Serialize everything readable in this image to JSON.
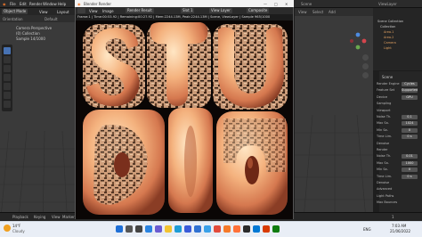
{
  "blender": {
    "menu": [
      "File",
      "Edit",
      "Render",
      "Window",
      "Help"
    ],
    "workspace_tabs": [
      "Object Mode",
      "View",
      "Layout"
    ],
    "left_viewport": {
      "header": [
        "Orientation",
        "Default",
        "Drag"
      ],
      "overlay_lines": [
        "Camera Perspective",
        "(0) Collection",
        "Sample 14/1000"
      ]
    },
    "right_viewport": {
      "header": [
        "View",
        "Select",
        "Add"
      ]
    },
    "outliner": {
      "title": "Scene",
      "view_layer": "ViewLayer",
      "items": [
        "Scene Collection",
        "Collection",
        "Area.1",
        "Area.2",
        "Camera",
        "Light"
      ]
    },
    "properties": {
      "scene_label": "Scene",
      "rows": [
        {
          "label": "Render Engine",
          "value": "Cycles"
        },
        {
          "label": "Feature Set",
          "value": "Supported"
        },
        {
          "label": "Device",
          "value": "GPU"
        },
        {
          "label": "Sampling",
          "value": ""
        },
        {
          "label": "Viewport",
          "value": ""
        },
        {
          "label": "Noise Th.",
          "value": "0.1"
        },
        {
          "label": "Max Sa.",
          "value": "1024"
        },
        {
          "label": "Min Sa.",
          "value": "0"
        },
        {
          "label": "Time Lim.",
          "value": "0 s"
        },
        {
          "label": "Denoise",
          "value": ""
        },
        {
          "label": "Render",
          "value": ""
        },
        {
          "label": "Noise Th.",
          "value": "0.01"
        },
        {
          "label": "Max Sa.",
          "value": "1000"
        },
        {
          "label": "Min Sa.",
          "value": "0"
        },
        {
          "label": "Time Lim.",
          "value": "0 s"
        },
        {
          "label": "Denoise",
          "value": ""
        },
        {
          "label": "Advanced",
          "value": ""
        },
        {
          "label": "Light Paths",
          "value": ""
        },
        {
          "label": "Max Bounces",
          "value": ""
        }
      ]
    },
    "timeline": {
      "items": [
        "Playback",
        "Keying",
        "View",
        "Marker"
      ],
      "frame": "1"
    }
  },
  "render_window": {
    "title": "Blender Render",
    "controls": [
      "—",
      "□",
      "✕"
    ],
    "header_buttons": [
      "View",
      "Image",
      "Render Result",
      "Slot 1",
      "View Layer",
      "Composite"
    ],
    "info": "Frame:1 | Time:00:53.92 | Remaining:00:27.92 | Mem:2244.13M, Peak:2244.13M | Scene, ViewLayer | Sample 965/1000",
    "letters": [
      "S",
      "T",
      "U",
      "D",
      "I",
      "O"
    ]
  },
  "taskbar": {
    "weather_temp": "14°F",
    "weather_desc": "Cloudy",
    "time": "7:03 AM",
    "date": "21/06/2022",
    "lang": "ENG",
    "icons": [
      {
        "name": "start-icon",
        "color": "#1f6fd6"
      },
      {
        "name": "search-taskbar-icon",
        "color": "#555555"
      },
      {
        "name": "task-view-icon",
        "color": "#444444"
      },
      {
        "name": "widgets-icon",
        "color": "#2a83e0"
      },
      {
        "name": "chat-icon",
        "color": "#6b5bd1"
      },
      {
        "name": "explorer-icon",
        "color": "#f2c230"
      },
      {
        "name": "edge-icon",
        "color": "#1d9cd6"
      },
      {
        "name": "store-icon",
        "color": "#3a5bd9"
      },
      {
        "name": "mail-icon",
        "color": "#2f71d1"
      },
      {
        "name": "photos-icon",
        "color": "#3aa0e8"
      },
      {
        "name": "chrome-icon",
        "color": "#e24b3b"
      },
      {
        "name": "blender-icon",
        "color": "#f5792a"
      },
      {
        "name": "firefox-icon",
        "color": "#ff7139"
      },
      {
        "name": "app-icon-1",
        "color": "#2b2b2b"
      },
      {
        "name": "app-icon-2",
        "color": "#0078d4"
      },
      {
        "name": "app-icon-3",
        "color": "#d83b01"
      },
      {
        "name": "app-icon-4",
        "color": "#107c10"
      }
    ]
  }
}
